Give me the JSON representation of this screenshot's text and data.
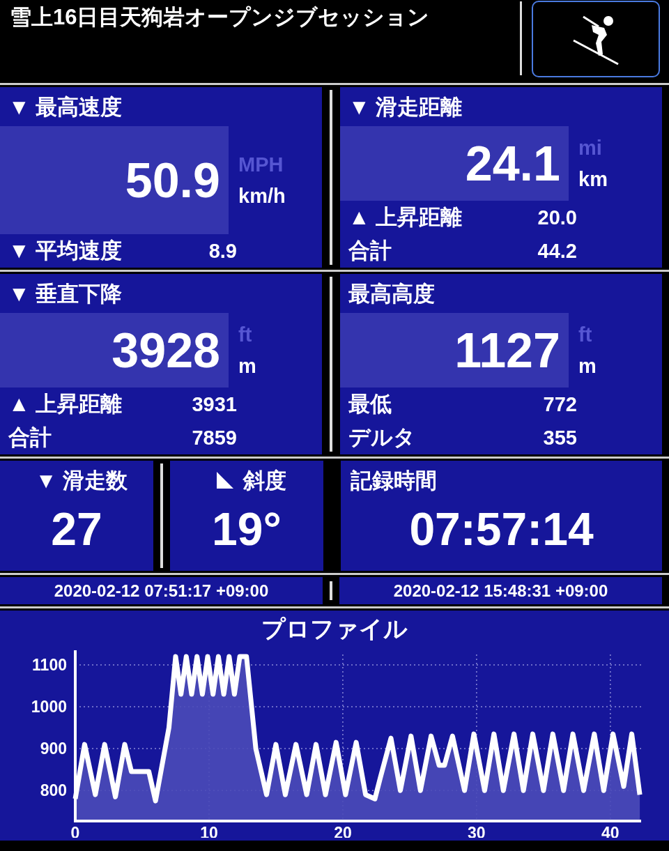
{
  "header": {
    "title": "雪上16日目天狗岩オープンジブセッション"
  },
  "stats": [
    {
      "label": "▼ 最高速度",
      "value": "50.9",
      "units": [
        {
          "label": "MPH",
          "selected": false
        },
        {
          "label": "km/h",
          "selected": true
        }
      ],
      "rows": [
        {
          "label": "▼ 平均速度",
          "value": "8.9"
        }
      ]
    },
    {
      "label": "▼ 滑走距離",
      "value": "24.1",
      "units": [
        {
          "label": "mi",
          "selected": false
        },
        {
          "label": "km",
          "selected": true
        }
      ],
      "rows": [
        {
          "label": "▲ 上昇距離",
          "value": "20.0"
        },
        {
          "label": "合計",
          "value": "44.2"
        }
      ]
    },
    {
      "label": "▼ 垂直下降",
      "value": "3928",
      "units": [
        {
          "label": "ft",
          "selected": false
        },
        {
          "label": "m",
          "selected": true
        }
      ],
      "rows": [
        {
          "label": "▲ 上昇距離",
          "value": "3931"
        },
        {
          "label": "合計",
          "value": "7859"
        }
      ]
    },
    {
      "label": "最高高度",
      "value": "1127",
      "units": [
        {
          "label": "ft",
          "selected": false
        },
        {
          "label": "m",
          "selected": true
        }
      ],
      "rows": [
        {
          "label": "最低",
          "value": "772"
        },
        {
          "label": "デルタ",
          "value": "355"
        }
      ]
    }
  ],
  "summary": [
    {
      "kind": "plain",
      "label": "▼ 滑走数",
      "value": "27"
    },
    {
      "kind": "slope",
      "label": "斜度",
      "value": "19°"
    },
    {
      "kind": "plain",
      "label": "記録時間",
      "value": "07:57:14"
    }
  ],
  "times": [
    "2020-02-12 07:51:17 +09:00",
    "2020-02-12 15:48:31 +09:00"
  ],
  "profile": {
    "chart_data": {
      "type": "area",
      "title": "プロファイル",
      "grid": true,
      "xlim": [
        0,
        42.3
      ],
      "ylim": [
        727,
        1125
      ],
      "xticks": [
        0,
        10,
        20,
        30,
        40
      ],
      "yticks": [
        800,
        900,
        1000,
        1100
      ],
      "x": [
        0,
        0.7,
        1.5,
        2.2,
        3,
        3.7,
        4.2,
        5.5,
        6,
        7,
        7.5,
        7.9,
        8.3,
        8.7,
        9.1,
        9.5,
        9.9,
        10.3,
        10.7,
        11.1,
        11.5,
        11.9,
        12.3,
        12.8,
        13.5,
        14.3,
        15,
        15.7,
        16.5,
        17.3,
        18,
        18.7,
        19.5,
        20.2,
        21,
        21.7,
        22.4,
        22.8,
        23.6,
        24.3,
        25.1,
        25.8,
        26.6,
        27.2,
        27.6,
        28.2,
        29.1,
        29.8,
        30.6,
        31.3,
        32,
        32.8,
        33.5,
        34.2,
        35,
        35.7,
        36.5,
        37.2,
        38,
        38.8,
        39.5,
        40.2,
        41,
        41.6,
        42.2
      ],
      "series": [
        {
          "color": "#ffffff",
          "values": [
            780,
            910,
            790,
            910,
            785,
            910,
            845,
            845,
            775,
            950,
            1120,
            1030,
            1120,
            1030,
            1120,
            1030,
            1120,
            1030,
            1120,
            1030,
            1120,
            1030,
            1120,
            1120,
            900,
            790,
            910,
            790,
            910,
            790,
            910,
            790,
            915,
            790,
            915,
            790,
            780,
            830,
            925,
            800,
            930,
            800,
            930,
            860,
            860,
            930,
            800,
            935,
            800,
            935,
            800,
            935,
            800,
            935,
            800,
            935,
            800,
            935,
            800,
            935,
            800,
            935,
            810,
            935,
            790
          ]
        }
      ]
    }
  }
}
